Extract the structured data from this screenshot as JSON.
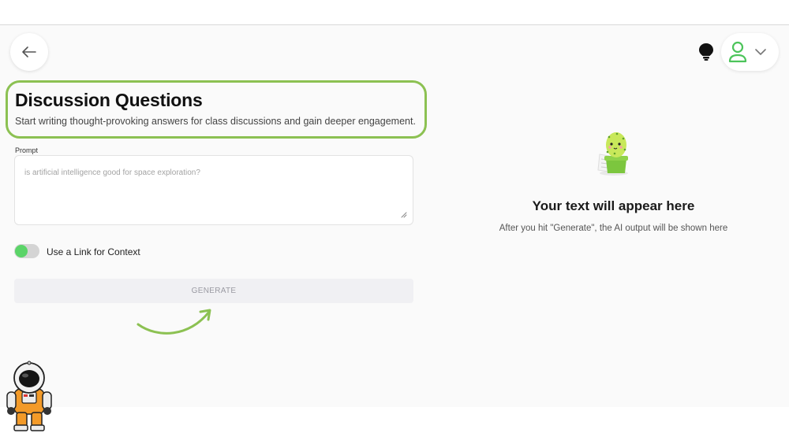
{
  "header": {
    "title": "Discussion Questions",
    "subtitle": "Start writing thought-provoking answers for class discussions and gain deeper engagement."
  },
  "nav": {
    "back_icon": "arrow-left-icon",
    "tips_icon": "lightbulb-icon",
    "user_icon": "user-icon",
    "menu_icon": "chevron-down-icon"
  },
  "form": {
    "prompt_label": "Prompt",
    "prompt_placeholder": "is artificial intelligence good for space exploration?",
    "prompt_value": "",
    "link_toggle_label": "Use a Link for Context",
    "link_toggle_on": false,
    "generate_label": "GENERATE"
  },
  "output": {
    "empty_title": "Your text will appear here",
    "empty_subtitle": "After you hit \"Generate\", the AI output will be shown here"
  },
  "colors": {
    "accent_green": "#8cc152",
    "toggle_knob": "#5bd468",
    "user_icon": "#4cc45a"
  }
}
